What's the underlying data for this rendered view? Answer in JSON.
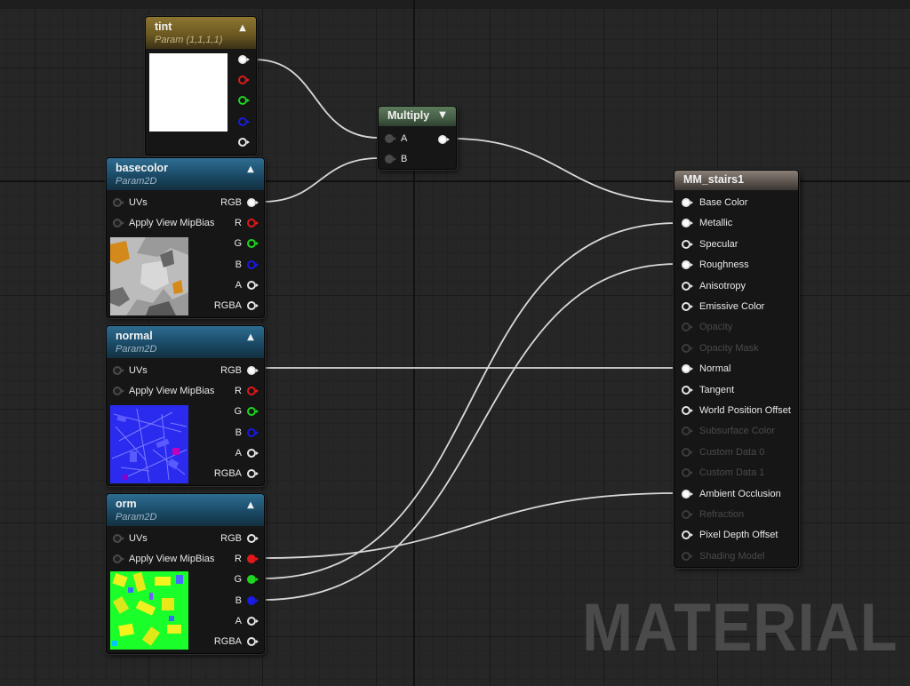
{
  "colors": {
    "pin_red": "#e01a1a",
    "pin_green": "#1ed61e",
    "pin_blue": "#1a1ae0",
    "pin_white": "#ffffff",
    "wire": "#d8d8d8",
    "header_param2d": "#1b4a66",
    "header_param": "#6c5921",
    "header_multiply": "#465e46",
    "header_material": "#5e5650"
  },
  "nodes": {
    "tint": {
      "title": "tint",
      "subtitle": "Param (1,1,1,1)",
      "preview_color": "#ffffff",
      "collapse_icon": "chevron-up-icon"
    },
    "basecolor": {
      "title": "basecolor",
      "subtitle": "Param2D",
      "inputs": [
        "UVs",
        "Apply View MipBias"
      ],
      "outputs": [
        "RGB",
        "R",
        "G",
        "B",
        "A",
        "RGBA"
      ],
      "collapse_icon": "chevron-up-icon"
    },
    "normal": {
      "title": "normal",
      "subtitle": "Param2D",
      "inputs": [
        "UVs",
        "Apply View MipBias"
      ],
      "outputs": [
        "RGB",
        "R",
        "G",
        "B",
        "A",
        "RGBA"
      ],
      "collapse_icon": "chevron-up-icon"
    },
    "orm": {
      "title": "orm",
      "subtitle": "Param2D",
      "inputs": [
        "UVs",
        "Apply View MipBias"
      ],
      "outputs": [
        "RGB",
        "R",
        "G",
        "B",
        "A",
        "RGBA"
      ],
      "collapse_icon": "chevron-up-icon"
    },
    "multiply": {
      "title": "Multiply",
      "inputs": [
        "A",
        "B"
      ],
      "collapse_icon": "chevron-down-icon"
    },
    "material": {
      "title": "MM_stairs1",
      "inputs": [
        {
          "label": "Base Color",
          "enabled": true,
          "connected": true
        },
        {
          "label": "Metallic",
          "enabled": true,
          "connected": true
        },
        {
          "label": "Specular",
          "enabled": true,
          "connected": false
        },
        {
          "label": "Roughness",
          "enabled": true,
          "connected": true
        },
        {
          "label": "Anisotropy",
          "enabled": true,
          "connected": false
        },
        {
          "label": "Emissive Color",
          "enabled": true,
          "connected": false
        },
        {
          "label": "Opacity",
          "enabled": false,
          "connected": false
        },
        {
          "label": "Opacity Mask",
          "enabled": false,
          "connected": false
        },
        {
          "label": "Normal",
          "enabled": true,
          "connected": true
        },
        {
          "label": "Tangent",
          "enabled": true,
          "connected": false
        },
        {
          "label": "World Position Offset",
          "enabled": true,
          "connected": false
        },
        {
          "label": "Subsurface Color",
          "enabled": false,
          "connected": false
        },
        {
          "label": "Custom Data 0",
          "enabled": false,
          "connected": false
        },
        {
          "label": "Custom Data 1",
          "enabled": false,
          "connected": false
        },
        {
          "label": "Ambient Occlusion",
          "enabled": true,
          "connected": true
        },
        {
          "label": "Refraction",
          "enabled": false,
          "connected": false
        },
        {
          "label": "Pixel Depth Offset",
          "enabled": true,
          "connected": false
        },
        {
          "label": "Shading Model",
          "enabled": false,
          "connected": false
        }
      ]
    }
  },
  "watermark": "MATERIAL"
}
